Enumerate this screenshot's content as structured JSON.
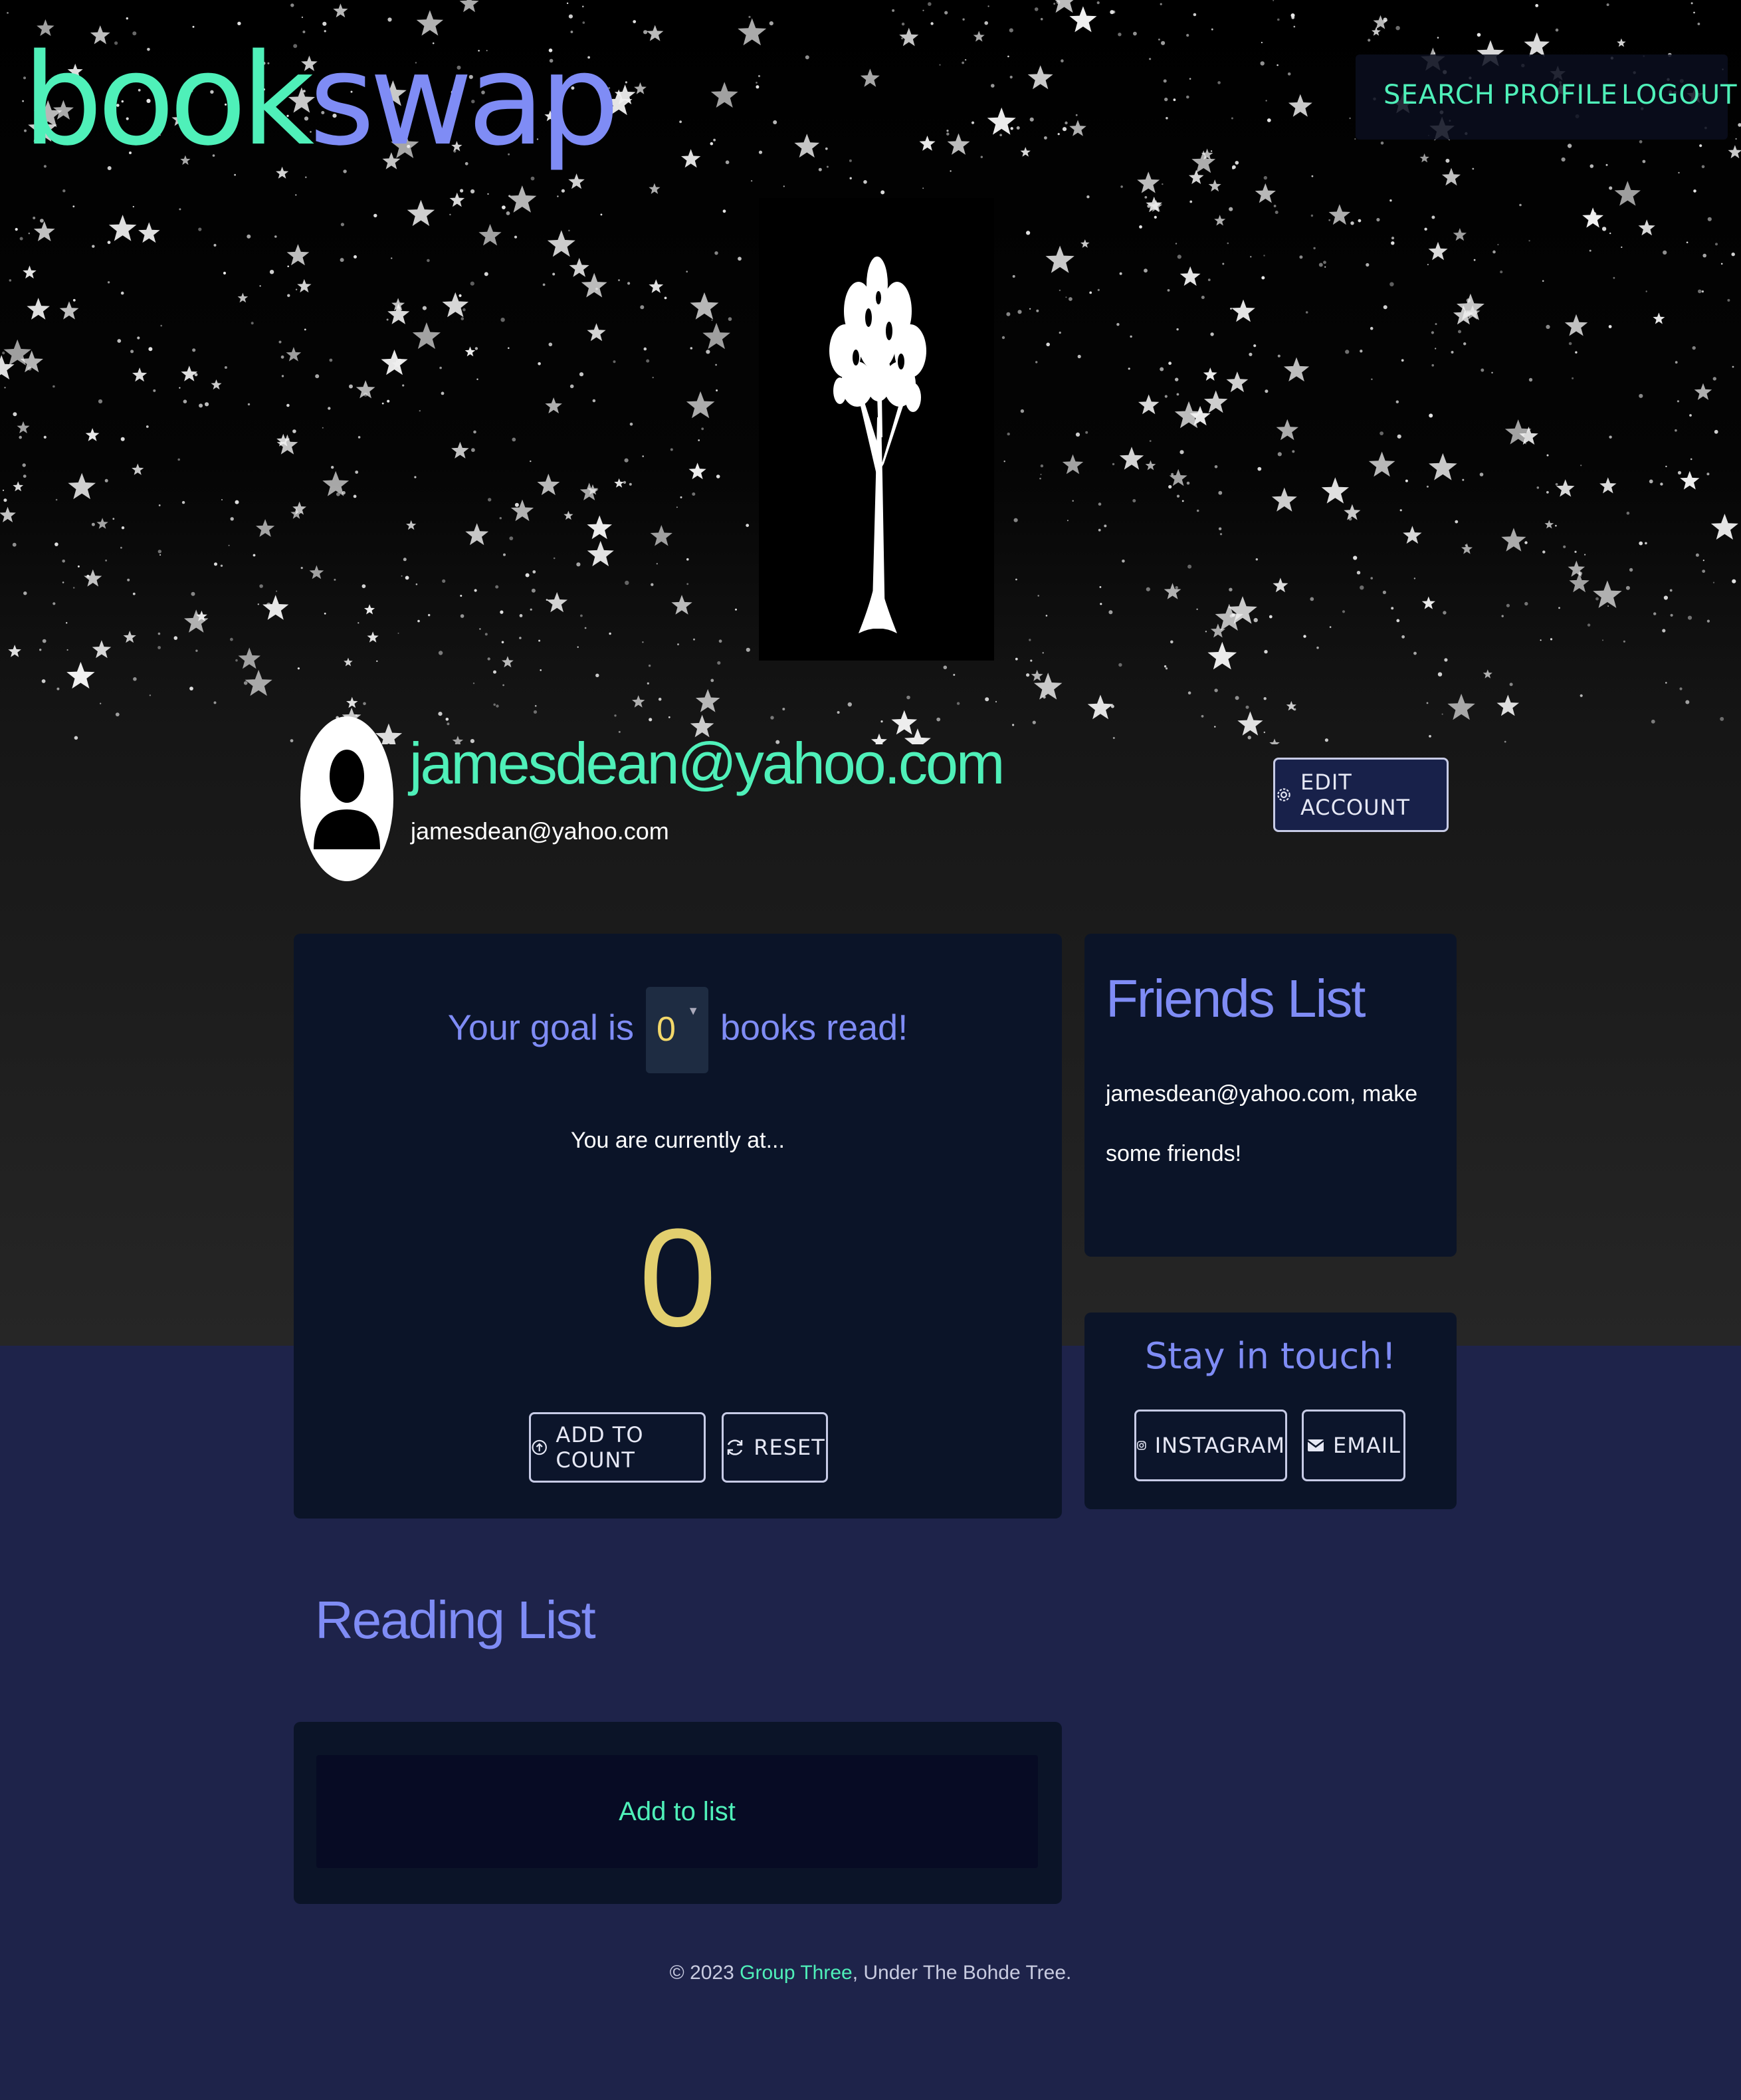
{
  "logo": {
    "part1": "book",
    "part2": "swap"
  },
  "nav": {
    "search": "SEARCH",
    "profile": "PROFILE",
    "logout": "LOGOUT"
  },
  "profile": {
    "username": "jamesdean@yahoo.com",
    "email": "jamesdean@yahoo.com",
    "edit_label": "EDIT ACCOUNT"
  },
  "goal": {
    "prefix": "Your goal is",
    "value": "0",
    "suffix": "books read!",
    "current_label": "You are currently at...",
    "count": "0",
    "add_label": "ADD TO COUNT",
    "reset_label": "RESET"
  },
  "friends": {
    "title": "Friends List",
    "empty_message": "jamesdean@yahoo.com, make some friends!"
  },
  "touch": {
    "title": "Stay in touch!",
    "instagram_label": "INSTAGRAM",
    "email_label": "EMAIL"
  },
  "reading": {
    "title": "Reading List",
    "add_label": "Add to list"
  },
  "footer": {
    "prefix": "© 2023",
    "group": "Group Three",
    "suffix": ", Under The Bohde Tree."
  },
  "colors": {
    "accent_green": "#4ff0b9",
    "accent_purple": "#7f8cf5",
    "count_yellow": "#e2cf6e",
    "page_bg": "#1e234a",
    "card_bg": "#0b1428"
  }
}
